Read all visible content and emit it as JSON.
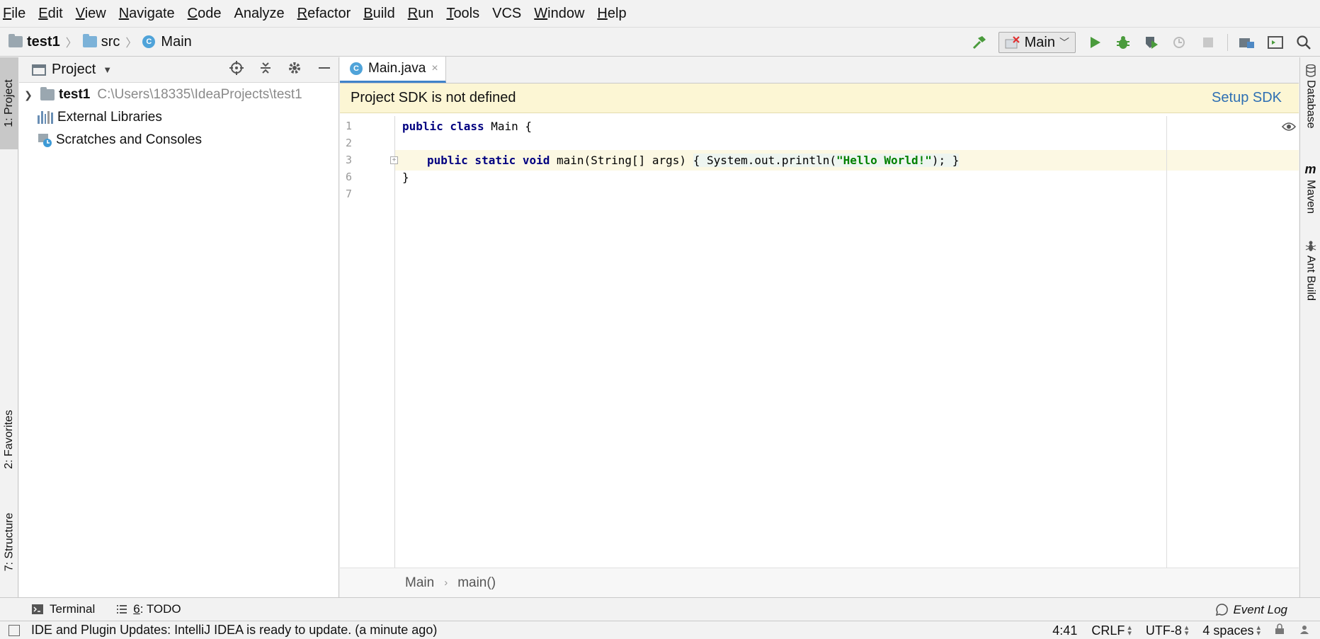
{
  "menu": [
    {
      "mnemonic": "F",
      "rest": "ile"
    },
    {
      "mnemonic": "E",
      "rest": "dit"
    },
    {
      "mnemonic": "V",
      "rest": "iew"
    },
    {
      "mnemonic": "N",
      "rest": "avigate"
    },
    {
      "mnemonic": "C",
      "rest": "ode"
    },
    {
      "mnemonic": "",
      "rest": "Analyze"
    },
    {
      "mnemonic": "R",
      "rest": "efactor"
    },
    {
      "mnemonic": "B",
      "rest": "uild"
    },
    {
      "mnemonic": "R",
      "rest": "un"
    },
    {
      "mnemonic": "T",
      "rest": "ools"
    },
    {
      "mnemonic": "",
      "rest": "VCS"
    },
    {
      "mnemonic": "W",
      "rest": "indow"
    },
    {
      "mnemonic": "H",
      "rest": "elp"
    }
  ],
  "breadcrumb": {
    "project": "test1",
    "folder": "src",
    "class": "Main",
    "class_icon_letter": "C"
  },
  "run_config": {
    "name": "Main"
  },
  "left_tabs": {
    "project": "1: Project",
    "favorites": "2: Favorites",
    "structure": "7: Structure"
  },
  "project_panel": {
    "title": "Project",
    "tree": {
      "root_name": "test1",
      "root_path": "C:\\Users\\18335\\IdeaProjects\\test1",
      "external_libraries": "External Libraries",
      "scratches": "Scratches and Consoles"
    }
  },
  "editor": {
    "tab_label": "Main.java",
    "tab_close": "×",
    "banner_text": "Project SDK is not defined",
    "banner_action": "Setup SDK",
    "line_numbers": [
      "1",
      "2",
      "3",
      "6",
      "7"
    ],
    "code": {
      "l1_kw": "public class",
      "l1_rest": " Main {",
      "l3_kw": "public static void",
      "l3_sig": " main(String[] args) ",
      "l3_body_open": "{ System.out.println(",
      "l3_str": "\"Hello World!\"",
      "l3_body_close": "); }",
      "l6": "}"
    },
    "breadcrumb_class": "Main",
    "breadcrumb_method": "main()"
  },
  "right_tabs": {
    "database": "Database",
    "maven": "Maven",
    "ant": "Ant Build"
  },
  "tool_windows": {
    "terminal": "Terminal",
    "todo_num": "6",
    "todo_rest": ": TODO",
    "event_log": "Event Log"
  },
  "status": {
    "message": "IDE and Plugin Updates: IntelliJ IDEA is ready to update. (a minute ago)",
    "position": "4:41",
    "line_sep": "CRLF",
    "encoding": "UTF-8",
    "indent": "4 spaces"
  },
  "colors": {
    "accent": "#4083c9",
    "run_green": "#4a9b3c",
    "banner_bg": "#fcf6d4",
    "link": "#2e6fb3"
  }
}
